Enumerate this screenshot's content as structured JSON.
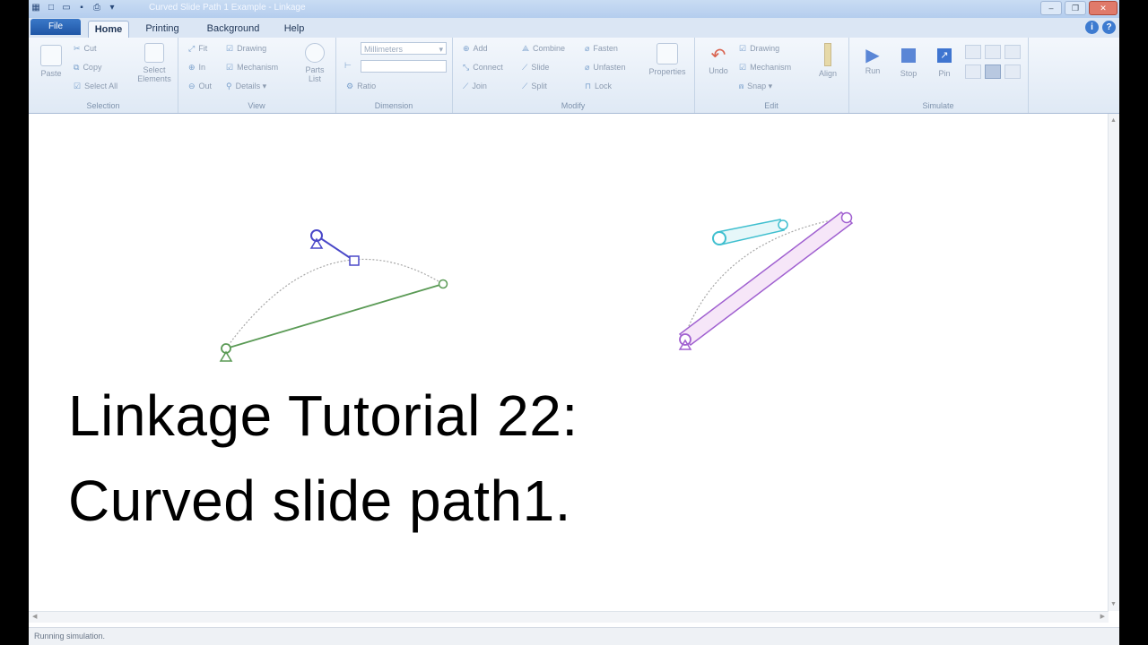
{
  "window": {
    "title": "Curved Slide Path 1 Example - Linkage",
    "quick_access": [
      "app-icon",
      "new-icon",
      "open-icon",
      "save-icon",
      "print-icon",
      "dropdown-icon"
    ],
    "controls": {
      "minimize": "–",
      "restore": "❐",
      "close": "✕"
    }
  },
  "ribbon": {
    "file_label": "File",
    "tabs": [
      "Home",
      "Printing",
      "Background",
      "Help"
    ],
    "help_icons": {
      "info": "i",
      "help": "?"
    },
    "groups": {
      "selection": {
        "label": "Selection",
        "paste": "Paste",
        "cut": "Cut",
        "copy": "Copy",
        "select_all": "Select All",
        "select_elements": "Select Elements"
      },
      "view": {
        "label": "View",
        "fit": "Fit",
        "in": "In",
        "out": "Out",
        "drawing": "Drawing",
        "mechanism": "Mechanism",
        "details": "Details",
        "parts_list": "Parts List"
      },
      "dimension": {
        "label": "Dimension",
        "units": "Millimeters",
        "value": "",
        "ratio": "Ratio"
      },
      "modify": {
        "label": "Modify",
        "add": "Add",
        "connect": "Connect",
        "join": "Join",
        "combine": "Combine",
        "slide": "Slide",
        "split": "Split",
        "fasten": "Fasten",
        "unfasten": "Unfasten",
        "lock": "Lock",
        "properties": "Properties"
      },
      "edit": {
        "label": "Edit",
        "undo": "Undo",
        "drawing": "Drawing",
        "mechanism": "Mechanism",
        "snap": "Snap",
        "align": "Align"
      },
      "simulate": {
        "label": "Simulate",
        "run": "Run",
        "stop": "Stop",
        "pin": "Pin"
      }
    }
  },
  "canvas": {
    "caption_line1": "Linkage Tutorial 22:",
    "caption_line2": "Curved slide path1.",
    "colors": {
      "blue": "#4a48c8",
      "green": "#5a9a55",
      "cyan": "#3fbfcf",
      "purple": "#a060d0",
      "pink_fill": "#f6e6f8",
      "path": "#a8a8a8"
    }
  },
  "status": {
    "text": "Running simulation."
  }
}
